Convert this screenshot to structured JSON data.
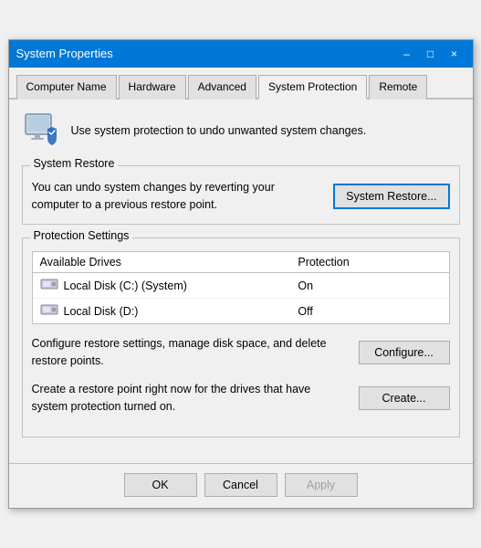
{
  "window": {
    "title": "System Properties",
    "close_label": "×",
    "minimize_label": "–",
    "maximize_label": "□"
  },
  "tabs": [
    {
      "label": "Computer Name",
      "active": false
    },
    {
      "label": "Hardware",
      "active": false
    },
    {
      "label": "Advanced",
      "active": false
    },
    {
      "label": "System Protection",
      "active": true
    },
    {
      "label": "Remote",
      "active": false
    }
  ],
  "header": {
    "description": "Use system protection to undo unwanted system changes."
  },
  "system_restore": {
    "group_label": "System Restore",
    "description": "You can undo system changes by reverting your computer to a previous restore point.",
    "button_label": "System Restore..."
  },
  "protection_settings": {
    "group_label": "Protection Settings",
    "column_drive": "Available Drives",
    "column_protection": "Protection",
    "drives": [
      {
        "name": "Local Disk (C:) (System)",
        "protection": "On"
      },
      {
        "name": "Local Disk (D:)",
        "protection": "Off"
      }
    ],
    "configure_desc": "Configure restore settings, manage disk space, and delete restore points.",
    "configure_label": "Configure...",
    "create_desc": "Create a restore point right now for the drives that have system protection turned on.",
    "create_label": "Create..."
  },
  "dialog_buttons": {
    "ok": "OK",
    "cancel": "Cancel",
    "apply": "Apply"
  }
}
